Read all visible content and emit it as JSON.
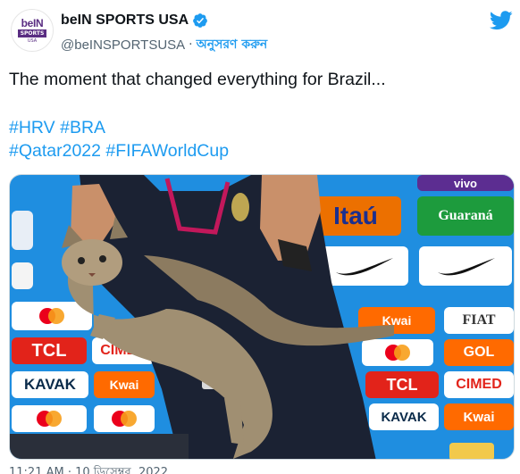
{
  "account": {
    "display_name": "beIN SPORTS USA",
    "handle": "@beINSPORTSUSA",
    "separator": "·",
    "follow_label": "অনুসরণ করুন",
    "avatar": {
      "logo_text": "beIN",
      "logo_sub": "SPORTS",
      "logo_region": "USA"
    }
  },
  "tweet": {
    "text": "The moment that changed everything for Brazil...",
    "hashtags_line1": [
      "#HRV",
      "#BRA"
    ],
    "hashtags_line2": [
      "#Qatar2022",
      "#FIFAWorldCup"
    ]
  },
  "media": {
    "sponsors": {
      "itau": "Itaú",
      "guarana": "Guaraná",
      "kwai": "Kwai",
      "fiat": "FIAT",
      "tcl": "TCL",
      "cimed": "CIMED",
      "gol": "GOL",
      "kavak": "KAVAK",
      "vivo": "vivo"
    }
  },
  "footer": {
    "timestamp_partial": "11:21 AM · 10 ডিসেম্বর, 2022"
  },
  "colors": {
    "brand_blue": "#1d9bf0",
    "logo_purple": "#5a2d82",
    "board_blue": "#1f8ee0"
  },
  "icons": {
    "verified": "verified-badge-icon",
    "platform": "twitter-bird-icon"
  }
}
